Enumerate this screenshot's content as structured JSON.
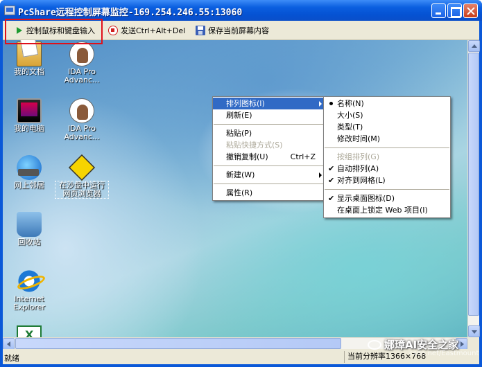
{
  "window": {
    "title": "PcShare远程控制屏幕监控-169.254.246.55:13060"
  },
  "toolbar": {
    "control_label": "控制鼠标和键盘输入",
    "send_cad_label": "发送Ctrl+Alt+Del",
    "save_screen_label": "保存当前屏幕内容"
  },
  "desktop_icons": [
    {
      "label": "我的文档",
      "icon": "my-documents-icon"
    },
    {
      "label": "IDA Pro Advanc...",
      "icon": "ida-pro-icon"
    },
    {
      "label": "我的电脑",
      "icon": "my-computer-icon"
    },
    {
      "label": "IDA Pro Advanc...",
      "icon": "ida-pro-icon"
    },
    {
      "label": "网上邻居",
      "icon": "network-places-icon"
    },
    {
      "label": "在沙盘中运行网页浏览器",
      "icon": "sandbox-icon"
    },
    {
      "label": "回收站",
      "icon": "recycle-bin-icon"
    },
    {
      "label": "Internet Explorer",
      "icon": "internet-explorer-icon"
    },
    {
      "label": "",
      "icon": "excel-icon"
    }
  ],
  "context_menu": {
    "items": [
      {
        "label": "排列图标(I)",
        "submenu": true,
        "active": true
      },
      {
        "label": "刷新(E)"
      },
      {
        "label": "粘贴(P)"
      },
      {
        "label": "粘贴快捷方式(S)",
        "disabled": true
      },
      {
        "label": "撤销复制(U)",
        "accel": "Ctrl+Z"
      },
      {
        "label": "新建(W)",
        "submenu": true
      },
      {
        "label": "属性(R)"
      }
    ]
  },
  "submenu": {
    "items": [
      {
        "label": "名称(N)",
        "mark": "dot"
      },
      {
        "label": "大小(S)"
      },
      {
        "label": "类型(T)"
      },
      {
        "label": "修改时间(M)"
      },
      {
        "label": "按组排列(G)",
        "disabled": true
      },
      {
        "label": "自动排列(A)",
        "mark": "check"
      },
      {
        "label": "对齐到网格(L)",
        "mark": "check"
      },
      {
        "label": "显示桌面图标(D)",
        "mark": "check"
      },
      {
        "label": "在桌面上锁定 Web 项目(I)"
      }
    ]
  },
  "statusbar": {
    "left": "就绪",
    "right": "当前分辨率1366×768"
  },
  "watermark": {
    "text": "娜璋AI安全之家",
    "sub": "csdn.net/Eastmount"
  },
  "colors": {
    "titlebar": "#0552d3",
    "menu_highlight": "#316ac5",
    "red_box": "#e0101a"
  }
}
